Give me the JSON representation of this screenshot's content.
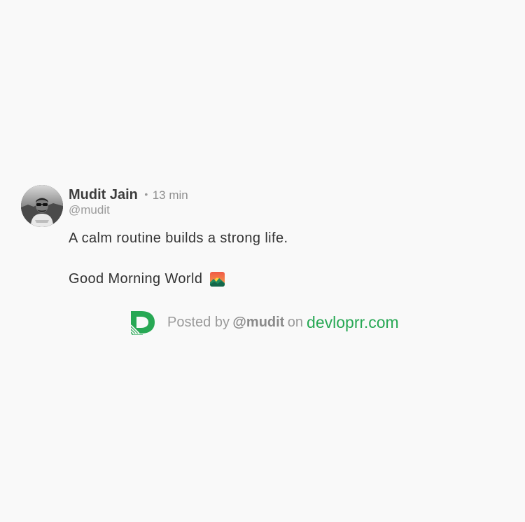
{
  "post": {
    "author": {
      "name": "Mudit Jain",
      "handle": "@mudit",
      "avatar": "profile-photo"
    },
    "separator": "•",
    "time": "13 min",
    "lines": [
      "A calm routine builds a strong life.",
      "Good Morning World"
    ],
    "emoji": "sunrise-over-mountains-icon"
  },
  "footer": {
    "logo": "devloprr-logo-icon",
    "prefix": "Posted by",
    "handle": "@mudit",
    "on": "on",
    "site": "devloprr.com"
  },
  "colors": {
    "background": "#f9f9f9",
    "accent": "#27a854",
    "name": "#3d3d3d",
    "muted": "#9a9a9a",
    "body": "#333333"
  }
}
